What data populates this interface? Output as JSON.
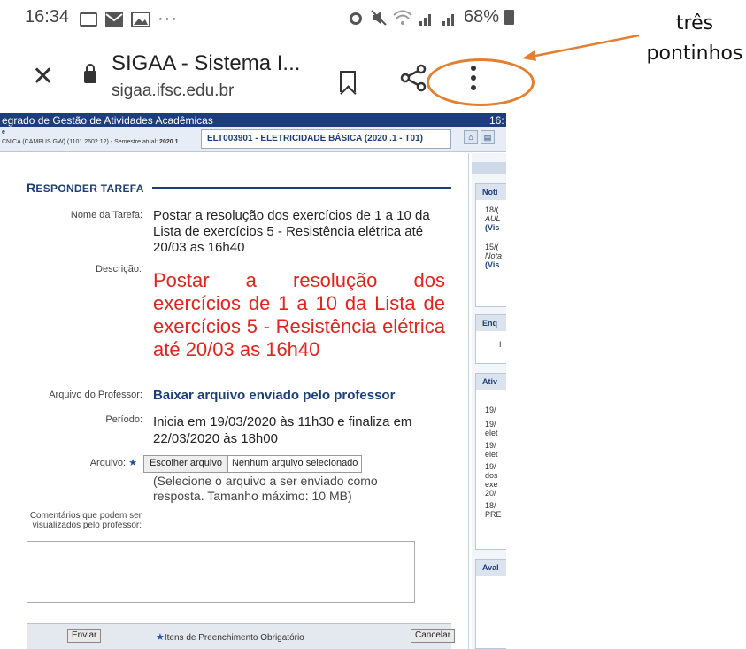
{
  "status_bar": {
    "time": "16:34",
    "left_icons": [
      "screen-icon",
      "mail-icon",
      "gallery-icon"
    ],
    "overflow": "···",
    "right_icons": [
      "alarm-icon",
      "mute-icon",
      "wifi-icon",
      "signal-icon",
      "signal-icon"
    ],
    "battery": "68%"
  },
  "browser": {
    "title": "SIGAA - Sistema I...",
    "url": "sigaa.ifsc.edu.br"
  },
  "annotation": {
    "label": "três pontinhos",
    "color": "#e57f30"
  },
  "sigaa": {
    "system_title": "egrado de Gestão de Atividades Acadêmicas",
    "system_time": "16:",
    "info_line1": "e",
    "info_line2": "CNICA (CAMPUS GW) (1101.2602.12) - Semestre atual: ",
    "semester": "2020.1",
    "course": "ELT003901 - ELETRICIDADE BÁSICA (2020 .1 - T01)",
    "form": {
      "title_first": "R",
      "title_rest": "ESPONDER TAREFA",
      "task_name_label": "Nome da Tarefa:",
      "task_name": "Postar a resolução dos exercícios de 1 a 10 da Lista de exercícios 5 - Resistência elétrica até 20/03 as 16h40",
      "description_label": "Descrição:",
      "description": "Postar a resolução dos exercícios de 1 a 10 da Lista de exercícios 5 - Resistência elétrica até 20/03 as 16h40",
      "teacher_file_label": "Arquivo do Professor:",
      "teacher_file_link": "Baixar arquivo enviado pelo professor",
      "period_label": "Período:",
      "period": "Inicia em 19/03/2020 às 11h30 e finaliza em 22/03/2020 às 18h00",
      "file_label": "Arquivo:",
      "required_star": "★",
      "choose_file": "Escolher arquivo",
      "no_file": "Nenhum arquivo selecionado",
      "file_hint": "(Selecione o arquivo a ser enviado como resposta. Tamanho máximo: 10 MB)",
      "comments_label": "Comentários que podem ser visualizados pelo professor:",
      "submit": "Enviar",
      "required_note": "Itens de Preenchimento Obrigatório",
      "cancel": "Cancelar"
    },
    "sidebar": {
      "news_head": "Noti",
      "news_items": [
        {
          "date": "18/(",
          "text": "AUL",
          "link": "(Vis"
        },
        {
          "date": "15/(",
          "text": "Nota",
          "link": "(Vis"
        }
      ],
      "poll_head": "Enq",
      "poll_text": "I",
      "activities_head": "Ativ",
      "activities": [
        "19/",
        "19/",
        "elet",
        "19/",
        "elet",
        "19/",
        "dos",
        "exe",
        "20/",
        "18/",
        "PRE"
      ],
      "eval_head": "Aval"
    }
  }
}
